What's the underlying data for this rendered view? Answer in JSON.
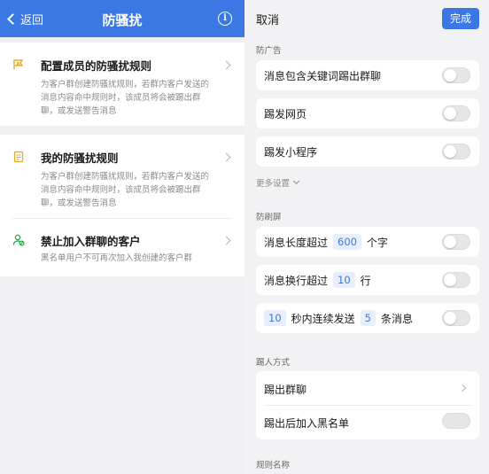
{
  "left": {
    "nav": {
      "back_label": "返回",
      "title": "防骚扰",
      "info_icon": "info-icon"
    },
    "items": [
      {
        "title": "配置成员的防骚扰规则",
        "desc": "为客户群创建防骚扰规则，若群内客户发送的消息内容命中规则时，该成员将会被踢出群聊，或发送警告消息",
        "icon": "flag-icon",
        "icon_color": "#e8a820"
      },
      {
        "title": "我的防骚扰规则",
        "desc": "为客户群创建防骚扰规则，若群内客户发送的消息内容命中规则时，该成员将会被踢出群聊，或发送警告消息",
        "icon": "document-icon",
        "icon_color": "#e8a820"
      },
      {
        "title": "禁止加入群聊的客户",
        "desc": "黑名单用户不可再次加入我创建的客户群",
        "icon": "user-block-icon",
        "icon_color": "#2ba24c"
      }
    ]
  },
  "right": {
    "cancel_label": "取消",
    "done_label": "完成",
    "sections": {
      "ads": "防广告",
      "flood": "防刷屏",
      "kick": "踢人方式",
      "rule_name": "规则名称"
    },
    "ads_rows": [
      {
        "label": "消息包含关键词踢出群聊",
        "on": false
      },
      {
        "label": "踢发网页",
        "on": false
      },
      {
        "label": "踢发小程序",
        "on": false
      }
    ],
    "more_settings": "更多设置",
    "flood_rows": {
      "length": {
        "prefix": "消息长度超过",
        "value": "600",
        "suffix": "个字",
        "on": false
      },
      "newline": {
        "prefix": "消息换行超过",
        "value": "10",
        "suffix": "行",
        "on": false
      },
      "rate": {
        "value1": "10",
        "middle": "秒内连续发送",
        "value2": "5",
        "suffix": "条消息",
        "on": false
      }
    },
    "kick_rows": [
      {
        "label": "踢出群聊"
      },
      {
        "label": "踢出后加入黑名单",
        "on": false
      }
    ]
  },
  "colors": {
    "accent": "#3c78e4",
    "warning_icon": "#e8a820",
    "user_icon": "#2ba24c"
  }
}
